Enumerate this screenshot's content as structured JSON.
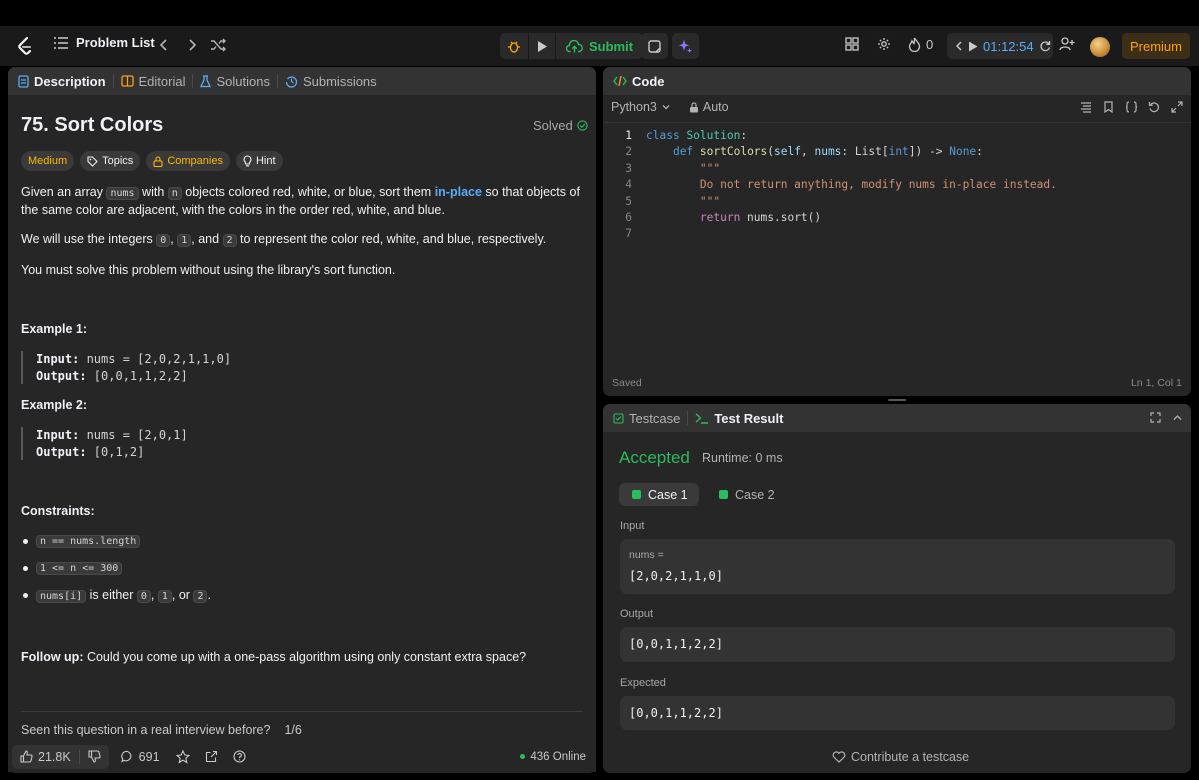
{
  "topbar": {
    "problem_list_label": "Problem List",
    "submit_label": "Submit",
    "streak_count": "0",
    "timer": "01:12:54",
    "premium_label": "Premium"
  },
  "left_tabs": [
    "Description",
    "Editorial",
    "Solutions",
    "Submissions"
  ],
  "problem": {
    "title": "75. Sort Colors",
    "status": "Solved",
    "tags": [
      "Medium",
      "Topics",
      "Companies",
      "Hint"
    ],
    "p1_a": "Given an array ",
    "p1_code1": "nums",
    "p1_b": " with ",
    "p1_code2": "n",
    "p1_c": " objects colored red, white, or blue, sort them ",
    "p1_link": "in-place",
    "p1_d": " so that objects of the same color are adjacent, with the colors in the order red, white, and blue.",
    "p2_a": "We will use the integers ",
    "p2_c0": "0",
    "p2_sep1": ", ",
    "p2_c1": "1",
    "p2_sep2": ", and ",
    "p2_c2": "2",
    "p2_b": " to represent the color red, white, and blue, respectively.",
    "p3": "You must solve this problem without using the library's sort function.",
    "example1_title": "Example 1:",
    "example1_input_label": "Input:",
    "example1_input": " nums = [2,0,2,1,1,0]",
    "example1_output_label": "Output:",
    "example1_output": " [0,0,1,1,2,2]",
    "example2_title": "Example 2:",
    "example2_input_label": "Input:",
    "example2_input": " nums = [2,0,1]",
    "example2_output_label": "Output:",
    "example2_output": " [0,1,2]",
    "constraints_title": "Constraints:",
    "constraint1": "n == nums.length",
    "constraint2": "1 <= n <= 300",
    "constraint3_code": "nums[i]",
    "constraint3_a": " is either ",
    "constraint3_c0": "0",
    "constraint3_sep1": ", ",
    "constraint3_c1": "1",
    "constraint3_sep2": ", or ",
    "constraint3_c2": "2",
    "constraint3_end": ".",
    "followup_label": "Follow up:",
    "followup_text": " Could you come up with a one-pass algorithm using only constant extra space?",
    "interview_question": "Seen this question in a real interview before?",
    "interview_pager": "1/6"
  },
  "footer": {
    "likes": "21.8K",
    "comments": "691",
    "online": "436 Online"
  },
  "code_panel": {
    "title": "Code",
    "language": "Python3",
    "mode": "Auto",
    "saved": "Saved",
    "cursor": "Ln 1, Col 1",
    "line_numbers": [
      "1",
      "2",
      "3",
      "4",
      "5",
      "6",
      "7"
    ],
    "code": {
      "l1_kw": "class",
      "l1_cls": "Solution",
      "l1_end": ":",
      "l2_kw": "def",
      "l2_fn": "sortColors",
      "l2_a": "(",
      "l2_self": "self",
      "l2_b": ", ",
      "l2_nums": "nums",
      "l2_c": ": List[",
      "l2_int": "int",
      "l2_d": "]) -> ",
      "l2_none": "None",
      "l2_e": ":",
      "l3": "\"\"\"",
      "l4": "Do not return anything, modify nums in-place instead.",
      "l5": "\"\"\"",
      "l6_kw": "return",
      "l6_rest": " nums.sort()"
    }
  },
  "result_panel": {
    "tab_testcase": "Testcase",
    "tab_result": "Test Result",
    "verdict": "Accepted",
    "runtime": "Runtime: 0 ms",
    "cases": [
      "Case 1",
      "Case 2"
    ],
    "input_label": "Input",
    "input_var": "nums =",
    "input_value": "[2,0,2,1,1,0]",
    "output_label": "Output",
    "output_value": "[0,0,1,1,2,2]",
    "expected_label": "Expected",
    "expected_value": "[0,0,1,1,2,2]",
    "contribute_label": "Contribute a testcase"
  },
  "colors": {
    "accent_green": "#2cbb5d",
    "brand_orange": "#ffa116",
    "link_blue": "#5cabf6",
    "medium_yellow": "#ffb800"
  },
  "icons": [
    "leetcode-logo-icon",
    "list-icon",
    "chevron-left-icon",
    "chevron-right-icon",
    "shuffle-icon",
    "debug-icon",
    "play-icon",
    "cloud-upload-icon",
    "note-icon",
    "sparkle-icon",
    "grid-icon",
    "gear-icon",
    "fire-icon",
    "refresh-icon",
    "add-user-icon",
    "thumbs-up-icon",
    "thumbs-down-icon",
    "comment-icon",
    "star-icon",
    "share-icon",
    "help-icon",
    "heart-icon"
  ]
}
